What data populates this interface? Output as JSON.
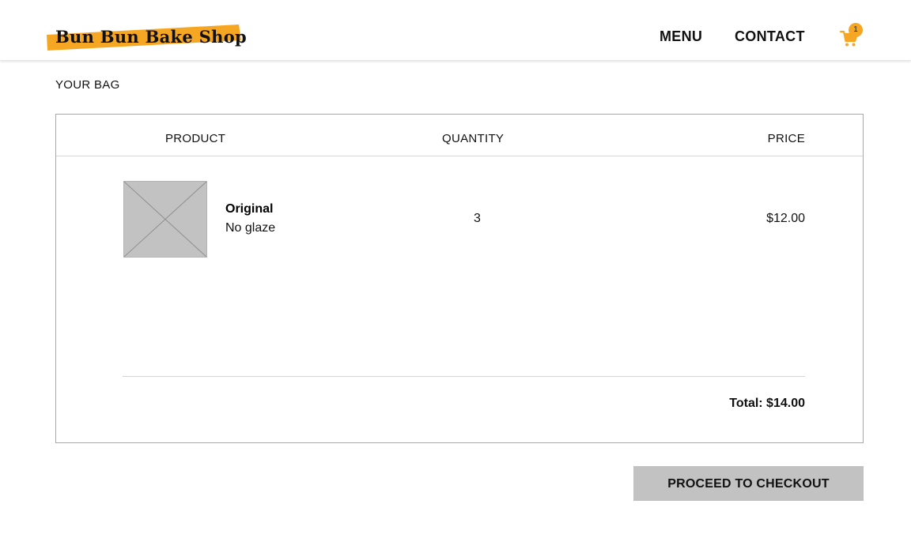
{
  "header": {
    "logo_text": "Bun Bun Bake Shop",
    "nav": {
      "menu_label": "MENU",
      "contact_label": "CONTACT"
    },
    "cart": {
      "icon": "shopping-cart-icon",
      "count": "1"
    }
  },
  "page": {
    "title": "YOUR BAG"
  },
  "bag": {
    "columns": {
      "product": "PRODUCT",
      "quantity": "QUANTITY",
      "price": "PRICE"
    },
    "items": [
      {
        "name": "Original",
        "glaze": "No glaze",
        "quantity": "3",
        "price": "$12.00"
      }
    ],
    "total": "Total: $14.00"
  },
  "checkout": {
    "label": "PROCEED TO CHECKOUT"
  },
  "colors": {
    "brand_orange": "#f5a623",
    "button_gray": "#c2c2c2",
    "border_gray": "#a8a8a8"
  }
}
